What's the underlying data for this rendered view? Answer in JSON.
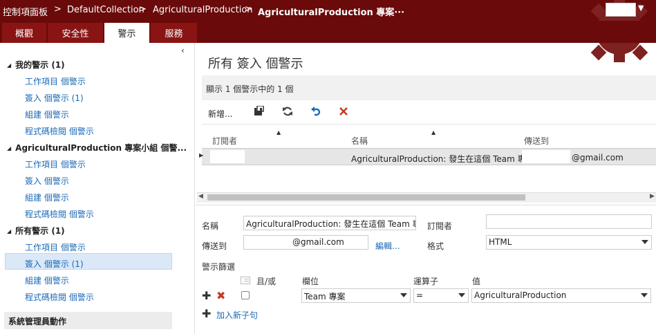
{
  "breadcrumbs": [
    {
      "label": "控制項面板"
    },
    {
      "label": "DefaultCollection"
    },
    {
      "label": "AgriculturalProduction"
    },
    {
      "label": "AgriculturalProduction 專案···"
    }
  ],
  "breadcrumb_separator": ">",
  "tabs": [
    {
      "label": "概觀",
      "active": false
    },
    {
      "label": "安全性",
      "active": false
    },
    {
      "label": "警示",
      "active": true
    },
    {
      "label": "服務",
      "active": false
    }
  ],
  "left": {
    "collapse_glyph": "‹",
    "groups": [
      {
        "title": "我的警示 (1)",
        "items": [
          "工作項目 個警示",
          "簽入 個警示 (1)",
          "組建 個警示",
          "程式碼檢閱 個警示"
        ]
      },
      {
        "title": "AgriculturalProduction 專案小組 個警...",
        "items": [
          "工作項目 個警示",
          "簽入 個警示",
          "組建 個警示",
          "程式碼檢閱 個警示"
        ]
      },
      {
        "title": "所有警示 (1)",
        "items": [
          "工作項目 個警示",
          "簽入 個警示 (1)",
          "組建 個警示",
          "程式碼檢閱 個警示"
        ]
      }
    ],
    "selected": "所有警示 > 簽入 個警示 (1)",
    "admin_section": "系統管理員動作"
  },
  "main": {
    "title": "所有 簽入 個警示",
    "count_text": "顯示 1 個警示中的 1 個",
    "toolbar": {
      "new_label": "新增..."
    },
    "columns": [
      "訂閱者",
      "名稱",
      "傳送到"
    ],
    "rows": [
      {
        "subscriber": "",
        "name": "AgriculturalProduction: 發生在這個 Team 專...",
        "send_to": "@gmail.com"
      }
    ]
  },
  "detail": {
    "name_label": "名稱",
    "name_value": "AgriculturalProduction: 發生在這個 Team 專案中",
    "subscriber_label": "訂閱者",
    "subscriber_value": "",
    "sendto_label": "傳送到",
    "sendto_value": "@gmail.com",
    "edit_link": "編輯...",
    "format_label": "格式",
    "format_value": "HTML",
    "filter_label": "警示篩選",
    "andor_label": "且/或",
    "field_label": "欄位",
    "operator_label": "運算子",
    "value_label": "值",
    "clause": {
      "field": "Team 專案",
      "operator": "=",
      "value": "AgriculturalProduction"
    },
    "add_clause": "加入新子句"
  },
  "colors": {
    "header": "#6a0a0a",
    "tab": "#8a1414",
    "link": "#1b69b6",
    "selection": "#dbe8f7",
    "delete": "#c23b22"
  },
  "icons": [
    "gear-icon",
    "save-icon",
    "refresh-icon",
    "undo-icon",
    "delete-icon",
    "plus-icon",
    "chevron-down-icon"
  ]
}
